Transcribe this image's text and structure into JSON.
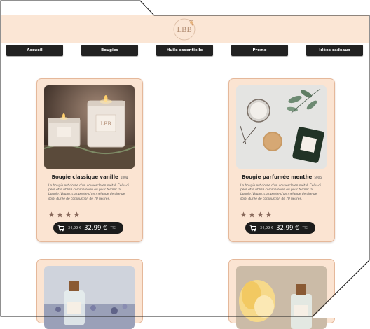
{
  "header": {
    "logo_text": "LBB"
  },
  "nav": {
    "items": [
      {
        "label": "Accueil"
      },
      {
        "label": "Bougies"
      },
      {
        "label": "Huile essentielle"
      },
      {
        "label": "Promo"
      },
      {
        "label": "Idées cadeaux"
      }
    ]
  },
  "products": [
    {
      "title": "Bougie classique vanille",
      "weight": "180g",
      "description": "La bougie est dotée d'un couvercle en métal. Celui-ci peut être utilisé comme socle ou pour fermer la bougie. Vegan, composée d'un mélange de cire de soja, durée de combustion de 70 heures.",
      "rating": 4,
      "old_price": "34,99 €",
      "price": "32,99 €",
      "tax_label": "TTC"
    },
    {
      "title": "Bougie parfumée menthe",
      "weight": "500g",
      "description": "La bougie est dotée d'un couvercle en métal. Celui-ci peut être utilisé comme socle ou pour fermer la bougie. Vegan, composée d'un mélange de cire de soja, durée de combustion de 70 heures.",
      "rating": 4,
      "old_price": "34,99 €",
      "price": "32,99 €",
      "tax_label": "TTC"
    }
  ],
  "colors": {
    "header_bg": "#fbe6d5",
    "card_bg": "#fbe4d2",
    "nav_bg": "#222222",
    "star": "#8a6a5c"
  }
}
